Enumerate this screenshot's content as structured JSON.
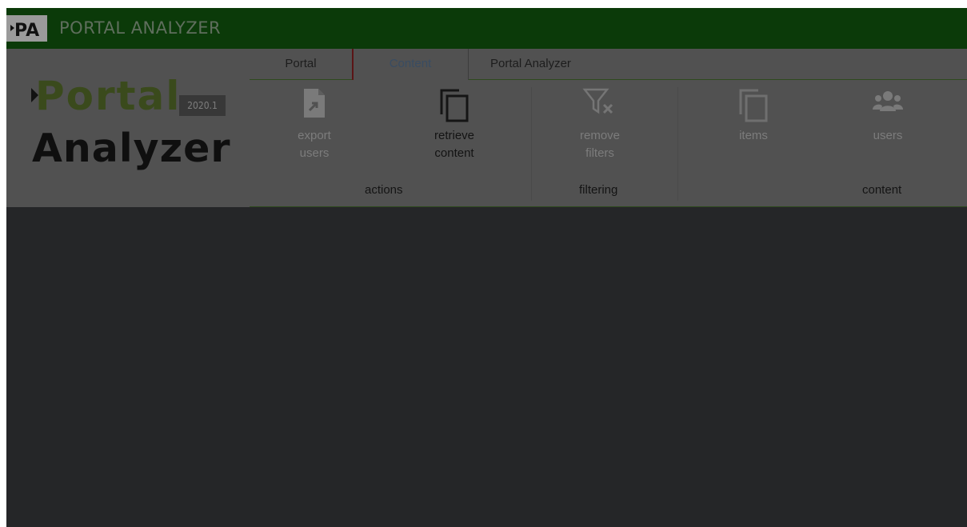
{
  "titlebar": {
    "logo": "PA",
    "title": "PORTAL ANALYZER"
  },
  "brand": {
    "portal": "Portal",
    "analyzer": "Analyzer",
    "version": "2020.1"
  },
  "tabs": [
    {
      "label": "Portal"
    },
    {
      "label": "Content"
    },
    {
      "label": "Portal Analyzer"
    }
  ],
  "ribbon": {
    "actions": {
      "label": "actions",
      "export_line1": "export",
      "export_line2": "users",
      "retrieve_line1": "retrieve",
      "retrieve_line2": "content"
    },
    "filtering": {
      "label": "filtering",
      "remove_line1": "remove",
      "remove_line2": "filters"
    },
    "content": {
      "label": "content",
      "items": "items",
      "users": "users"
    }
  },
  "colors": {
    "titlebar": "#0b3a09",
    "ribbon": "#515151",
    "workspace": "#252628",
    "brand_green": "#3a4a1c"
  }
}
